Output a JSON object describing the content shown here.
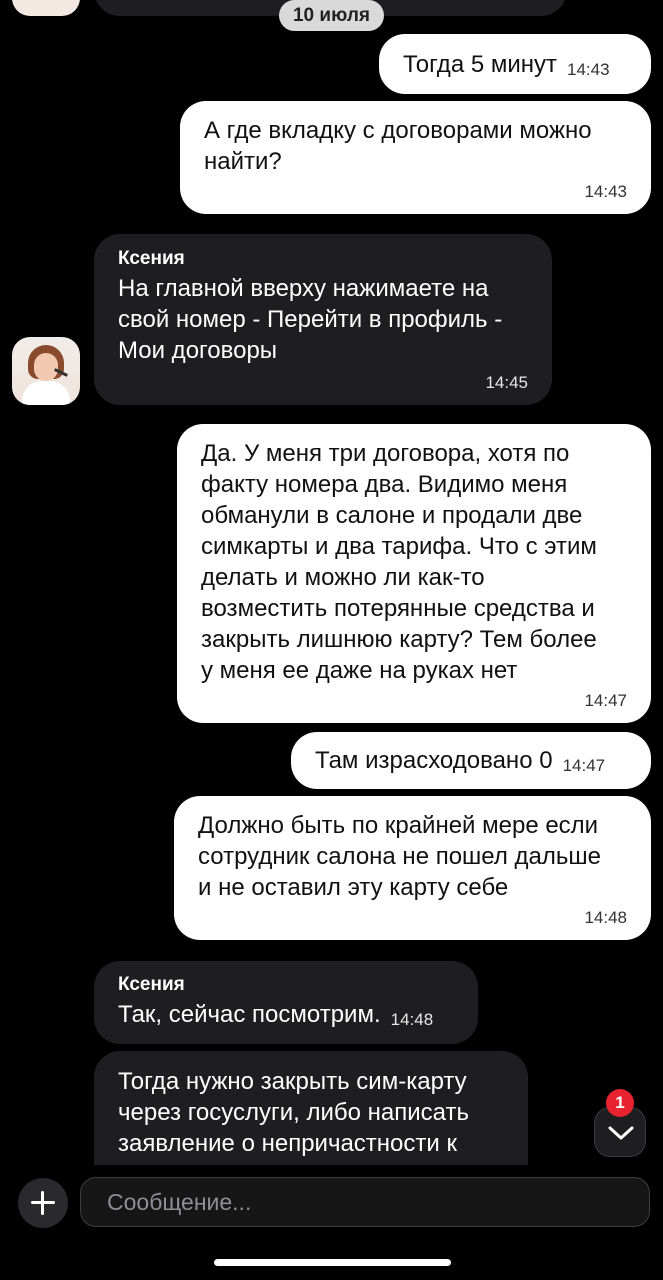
{
  "date_pill": "10 июля",
  "messages": [
    {
      "id": "m1",
      "direction": "out",
      "text": "Тогда 5 минут",
      "time": "14:43"
    },
    {
      "id": "m2",
      "direction": "out",
      "text": "А где вкладку с договорами можно\nнайти?",
      "time": "14:43"
    },
    {
      "id": "m3",
      "direction": "in",
      "sender": "Ксения",
      "text": "На главной вверху нажимаете на\nсвой номер - Перейти в профиль -\nМои договоры",
      "time": "14:45"
    },
    {
      "id": "m4",
      "direction": "out",
      "text": "Да. У меня три договора, хотя по\nфакту номера два. Видимо меня\nобманули в салоне и продали две\nсимкарты и два тарифа. Что с этим\nделать и можно ли как-то\nвозместить потерянные средства и\nзакрыть лишнюю карту? Тем более\nу меня ее даже на руках нет",
      "time": "14:47"
    },
    {
      "id": "m5",
      "direction": "out",
      "text": "Там израсходовано 0",
      "time": "14:47"
    },
    {
      "id": "m6",
      "direction": "out",
      "text": "Должно быть по крайней мере если\nсотрудник салона не пошел дальше\nи не оставил эту карту себе",
      "time": "14:48"
    },
    {
      "id": "m7",
      "direction": "in",
      "sender": "Ксения",
      "text": "Так, сейчас посмотрим.",
      "time": "14:48"
    },
    {
      "id": "m8",
      "direction": "in",
      "text": "Тогда нужно закрыть сим-карту\nчерез госуслуги, либо написать\nзаявление о непричастности к"
    }
  ],
  "scroll_down": {
    "badge_count": "1",
    "icon": "chevron-down-icon"
  },
  "composer": {
    "placeholder": "Сообщение...",
    "value": "",
    "add_icon": "plus-icon"
  },
  "colors": {
    "background": "#000000",
    "outgoing_bubble": "#ffffff",
    "incoming_bubble": "#1e1e20",
    "badge": "#e8232f"
  }
}
